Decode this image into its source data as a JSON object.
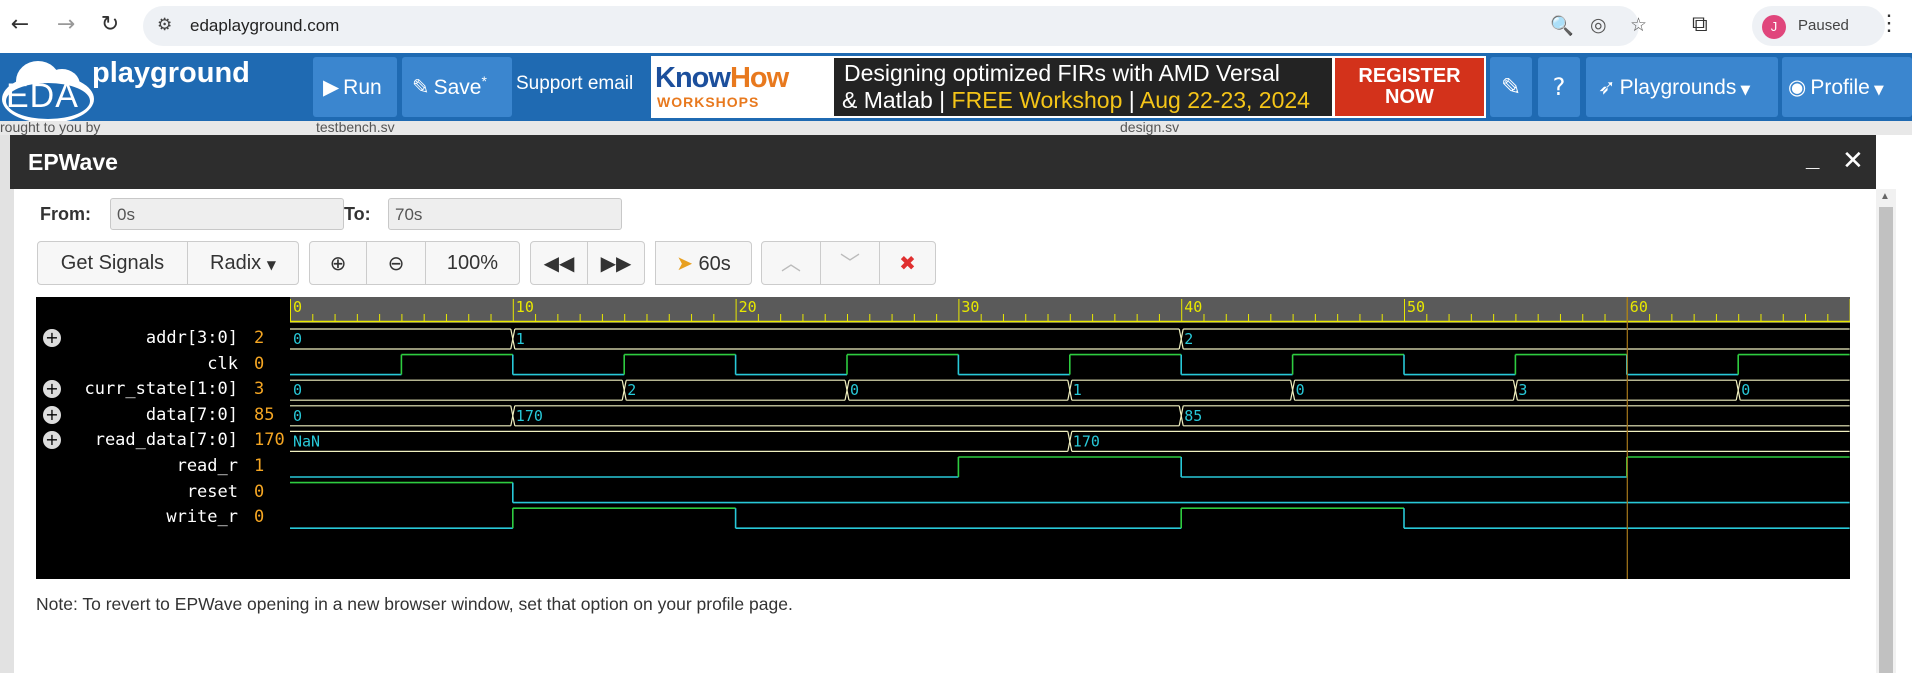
{
  "browser": {
    "url": "edaplayground.com",
    "profile_initial": "J",
    "profile_status": "Paused"
  },
  "header": {
    "logo_eda": "EDA",
    "logo_playground": "playground",
    "run_label": "Run",
    "save_label": "Save",
    "save_star": "*",
    "support_text": "Support email",
    "banner": {
      "brand_know": "Know",
      "brand_how": "How",
      "brand_sub": "WORKSHOPS",
      "line1": "Designing optimized FIRs with AMD Versal",
      "line2_a": "& Matlab | ",
      "line2_b": "FREE Workshop",
      "line2_c": " | ",
      "line2_d": "Aug 22-23, 2024",
      "register_1": "REGISTER",
      "register_2": "NOW"
    },
    "playgrounds_label": "Playgrounds",
    "profile_label": "Profile"
  },
  "background": {
    "brought": "rought to you by",
    "tab1": "testbench.sv",
    "tab2": "design.sv"
  },
  "modal": {
    "title": "EPWave",
    "from_label": "From:",
    "from_value": "0s",
    "to_label": "To:",
    "to_value": "70s",
    "toolbar": {
      "get_signals": "Get Signals",
      "radix": "Radix",
      "zoom_level": "100%",
      "cursor_time": "60s"
    },
    "note": "Note: To revert to EPWave opening in a new browser window, set that option on your profile page."
  },
  "waveform": {
    "time_range": [
      0,
      70
    ],
    "major_ticks": [
      "0",
      "10",
      "20",
      "30",
      "40",
      "50",
      "60"
    ],
    "cursor_time": 60,
    "signals": [
      {
        "name": "addr[3:0]",
        "value": "2",
        "expandable": true,
        "kind": "bus",
        "segments": [
          {
            "t": 0,
            "v": "0"
          },
          {
            "t": 10,
            "v": "1"
          },
          {
            "t": 40,
            "v": "2"
          }
        ]
      },
      {
        "name": "clk",
        "value": "0",
        "expandable": false,
        "kind": "bit",
        "transitions": [
          {
            "t": 0,
            "v": 0
          },
          {
            "t": 5,
            "v": 1
          },
          {
            "t": 10,
            "v": 0
          },
          {
            "t": 15,
            "v": 1
          },
          {
            "t": 20,
            "v": 0
          },
          {
            "t": 25,
            "v": 1
          },
          {
            "t": 30,
            "v": 0
          },
          {
            "t": 35,
            "v": 1
          },
          {
            "t": 40,
            "v": 0
          },
          {
            "t": 45,
            "v": 1
          },
          {
            "t": 50,
            "v": 0
          },
          {
            "t": 55,
            "v": 1
          },
          {
            "t": 60,
            "v": 0
          },
          {
            "t": 65,
            "v": 1
          },
          {
            "t": 70,
            "v": 0
          }
        ]
      },
      {
        "name": "curr_state[1:0]",
        "value": "3",
        "expandable": true,
        "kind": "bus",
        "segments": [
          {
            "t": 0,
            "v": "0"
          },
          {
            "t": 15,
            "v": "2"
          },
          {
            "t": 25,
            "v": "0"
          },
          {
            "t": 35,
            "v": "1"
          },
          {
            "t": 45,
            "v": "0"
          },
          {
            "t": 55,
            "v": "3"
          },
          {
            "t": 65,
            "v": "0"
          }
        ]
      },
      {
        "name": "data[7:0]",
        "value": "85",
        "expandable": true,
        "kind": "bus",
        "segments": [
          {
            "t": 0,
            "v": "0"
          },
          {
            "t": 10,
            "v": "170"
          },
          {
            "t": 40,
            "v": "85"
          }
        ]
      },
      {
        "name": "read_data[7:0]",
        "value": "170",
        "expandable": true,
        "kind": "bus",
        "segments": [
          {
            "t": 0,
            "v": "NaN"
          },
          {
            "t": 35,
            "v": "170"
          }
        ]
      },
      {
        "name": "read_r",
        "value": "1",
        "expandable": false,
        "kind": "bit",
        "transitions": [
          {
            "t": 0,
            "v": 0
          },
          {
            "t": 30,
            "v": 1
          },
          {
            "t": 40,
            "v": 0
          },
          {
            "t": 60,
            "v": 1
          }
        ]
      },
      {
        "name": "reset",
        "value": "0",
        "expandable": false,
        "kind": "bit",
        "transitions": [
          {
            "t": 0,
            "v": 1
          },
          {
            "t": 10,
            "v": 0
          }
        ]
      },
      {
        "name": "write_r",
        "value": "0",
        "expandable": false,
        "kind": "bit",
        "transitions": [
          {
            "t": 0,
            "v": 0
          },
          {
            "t": 10,
            "v": 1
          },
          {
            "t": 20,
            "v": 0
          },
          {
            "t": 40,
            "v": 1
          },
          {
            "t": 50,
            "v": 0
          }
        ]
      }
    ]
  },
  "colors": {
    "header_blue": "#1f6ab2",
    "wave_green": "#2ecc40",
    "wave_cyan": "#28c8d8",
    "bus_line": "#f0f0c0",
    "ruler_yellow": "#e8e800",
    "value_orange": "#f5a623",
    "cursor": "#a8781a"
  }
}
